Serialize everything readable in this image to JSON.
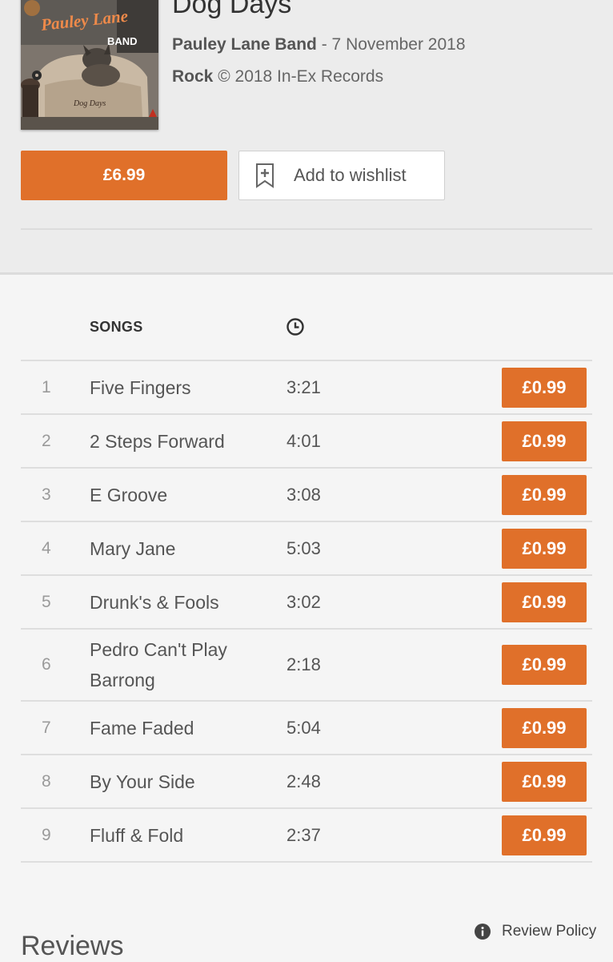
{
  "album": {
    "title": "Dog Days",
    "artist": "Pauley Lane Band",
    "release_date": "- 7 November 2018",
    "genre": "Rock",
    "copyright": "© 2018 In-Ex Records",
    "cover_text": {
      "band_name": "Pauley Lane",
      "band_suffix": "BAND",
      "album": "Dog Days"
    }
  },
  "actions": {
    "buy_label": "£6.99",
    "wishlist_label": "Add to wishlist"
  },
  "songs_table": {
    "header_songs": "SONGS",
    "duration_icon": "clock-icon",
    "rows": [
      {
        "num": "1",
        "title": "Five Fingers",
        "duration": "3:21",
        "price": "£0.99"
      },
      {
        "num": "2",
        "title": "2 Steps Forward",
        "duration": "4:01",
        "price": "£0.99"
      },
      {
        "num": "3",
        "title": "E Groove",
        "duration": "3:08",
        "price": "£0.99"
      },
      {
        "num": "4",
        "title": "Mary Jane",
        "duration": "5:03",
        "price": "£0.99"
      },
      {
        "num": "5",
        "title": "Drunk's & Fools",
        "duration": "3:02",
        "price": "£0.99"
      },
      {
        "num": "6",
        "title": "Pedro Can't Play Barrong",
        "duration": "2:18",
        "price": "£0.99"
      },
      {
        "num": "7",
        "title": "Fame Faded",
        "duration": "5:04",
        "price": "£0.99"
      },
      {
        "num": "8",
        "title": "By Your Side",
        "duration": "2:48",
        "price": "£0.99"
      },
      {
        "num": "9",
        "title": "Fluff & Fold",
        "duration": "2:37",
        "price": "£0.99"
      }
    ]
  },
  "reviews": {
    "heading": "Reviews",
    "policy_label": "Review Policy",
    "policy_icon": "info-icon"
  },
  "colors": {
    "accent": "#e0702a",
    "header_bg": "#ececec",
    "page_bg": "#f5f5f5"
  }
}
